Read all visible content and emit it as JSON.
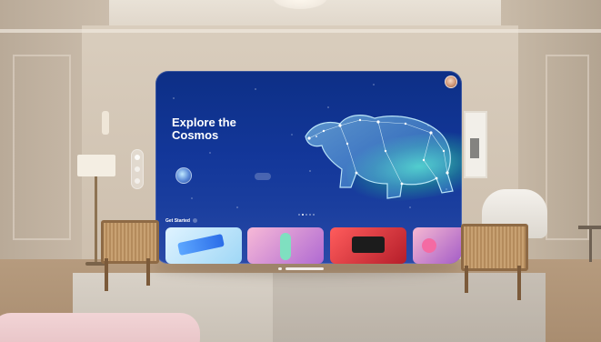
{
  "app": {
    "hero": {
      "eyebrow": "",
      "title": "Explore the Cosmos",
      "description": "",
      "guide_title": "",
      "guide_subtitle": "",
      "button_label": "",
      "button_caption": ""
    },
    "section": {
      "title": "Get Started"
    },
    "cards": [
      {
        "name": "card-1"
      },
      {
        "name": "card-2"
      },
      {
        "name": "card-3"
      },
      {
        "name": "card-4"
      }
    ],
    "pagination": {
      "pages": 5,
      "active": 1
    }
  },
  "colors": {
    "window_top": "#0d2f86",
    "window_bottom": "#2a4aa8",
    "aurora": "#50ffbe",
    "bear_glow": "#9fe7ff"
  },
  "icons": {
    "profile": "avatar",
    "section": "chevron-right-icon",
    "tabs": [
      "home-icon",
      "apps-icon",
      "people-icon"
    ]
  }
}
